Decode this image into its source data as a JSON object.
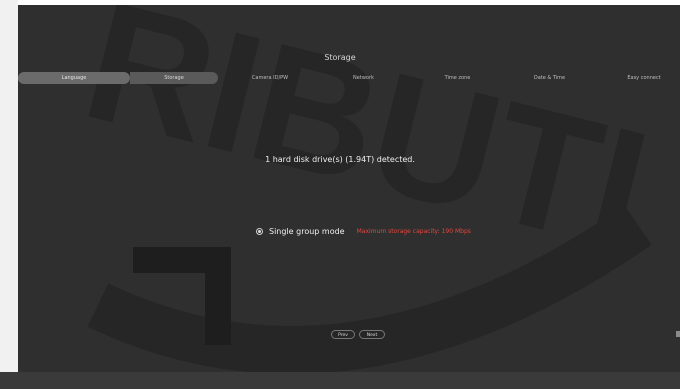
{
  "window": {
    "title": "Storage"
  },
  "steps": [
    {
      "label": "Language",
      "active": true
    },
    {
      "label": "Storage",
      "active": true
    },
    {
      "label": "Camera ID/PW",
      "active": false
    },
    {
      "label": "Network",
      "active": false
    },
    {
      "label": "Time zone",
      "active": false
    },
    {
      "label": "Date & Time",
      "active": false
    },
    {
      "label": "Easy connect",
      "active": false
    }
  ],
  "main": {
    "hdd_status": "1 hard disk drive(s) (1.94T) detected.",
    "mode_label": "Single group mode",
    "capacity_note": "Maximum storage capacity: 190 Mbps"
  },
  "footer": {
    "prev_label": "Prev",
    "next_label": "Next"
  },
  "watermark": {
    "text": "RIBUTI"
  },
  "colors": {
    "background": "#2f2f2f",
    "warning": "#e0473f",
    "pill": "#6b6b6b"
  }
}
